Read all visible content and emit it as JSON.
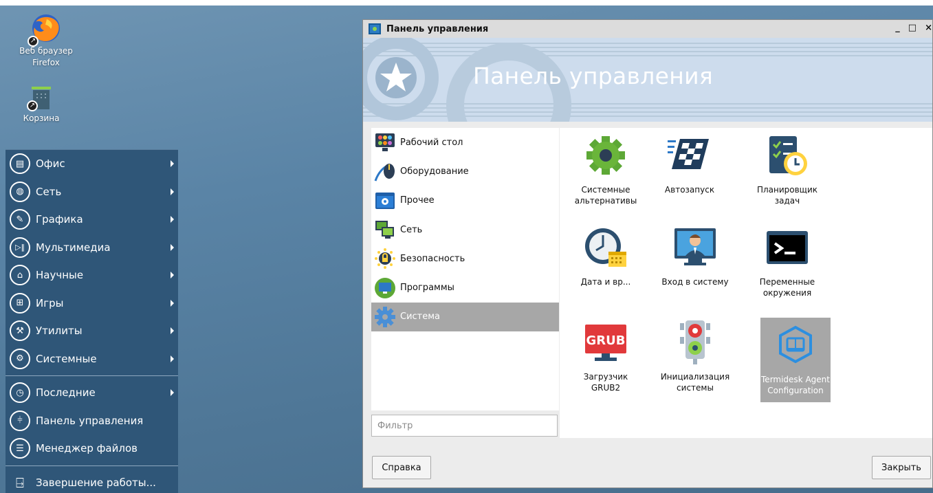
{
  "desktop": {
    "icons": [
      {
        "label": "Веб браузер Firefox",
        "icon": "firefox-icon"
      },
      {
        "label": "Корзина",
        "icon": "trash-icon"
      }
    ]
  },
  "start_menu": {
    "items": [
      {
        "label": "Офис",
        "icon": "office-icon",
        "submenu": true
      },
      {
        "label": "Сеть",
        "icon": "network-globe-icon",
        "submenu": true
      },
      {
        "label": "Графика",
        "icon": "graphics-pen-icon",
        "submenu": true
      },
      {
        "label": "Мультимедиа",
        "icon": "multimedia-icon",
        "submenu": true
      },
      {
        "label": "Научные",
        "icon": "science-cap-icon",
        "submenu": true
      },
      {
        "label": "Игры",
        "icon": "gamepad-icon",
        "submenu": true
      },
      {
        "label": "Утилиты",
        "icon": "wrench-icon",
        "submenu": true
      },
      {
        "label": "Системные",
        "icon": "gear-icon",
        "submenu": true
      }
    ],
    "recent": [
      {
        "label": "Последние",
        "icon": "clock-icon",
        "submenu": true
      },
      {
        "label": "Панель управления",
        "icon": "sliders-icon",
        "submenu": false
      },
      {
        "label": "Менеджер файлов",
        "icon": "file-manager-icon",
        "submenu": false
      }
    ],
    "shutdown": {
      "label": "Завершение работы...",
      "icon": "exit-door-icon"
    }
  },
  "window": {
    "title": "Панель управления",
    "controls": {
      "minimize": "_",
      "maximize": "□",
      "close": "×"
    },
    "banner_title": "Панель управления",
    "categories": [
      {
        "label": "Рабочий стол",
        "icon": "desktop-palette-icon",
        "selected": false
      },
      {
        "label": "Оборудование",
        "icon": "hardware-mouse-icon",
        "selected": false
      },
      {
        "label": "Прочее",
        "icon": "misc-gear-window-icon",
        "selected": false
      },
      {
        "label": "Сеть",
        "icon": "network-monitors-icon",
        "selected": false
      },
      {
        "label": "Безопасность",
        "icon": "security-lock-icon",
        "selected": false
      },
      {
        "label": "Программы",
        "icon": "programs-monitor-icon",
        "selected": false
      },
      {
        "label": "Система",
        "icon": "system-gear-icon",
        "selected": true
      }
    ],
    "filter_placeholder": "Фильтр",
    "apps": [
      {
        "label": "Системные альтернативы",
        "icon": "system-alternatives-gear-icon"
      },
      {
        "label": "Автозапуск",
        "icon": "autostart-flag-icon"
      },
      {
        "label": "Планировщик задач",
        "icon": "task-scheduler-icon"
      },
      {
        "label": "Дата и вр...",
        "icon": "date-time-clock-icon"
      },
      {
        "label": "Вход в систему",
        "icon": "login-user-icon"
      },
      {
        "label": "Переменные окружения",
        "icon": "terminal-icon"
      },
      {
        "label": "Загрузчик GRUB2",
        "icon": "grub-monitor-icon",
        "badge": "GRUB"
      },
      {
        "label": "Инициализация системы",
        "icon": "traffic-light-icon"
      },
      {
        "label": "Termidesk Agent Configuration",
        "icon": "termidesk-hexagon-icon",
        "selected": true
      }
    ],
    "help_button": "Справка",
    "close_button": "Закрыть"
  }
}
